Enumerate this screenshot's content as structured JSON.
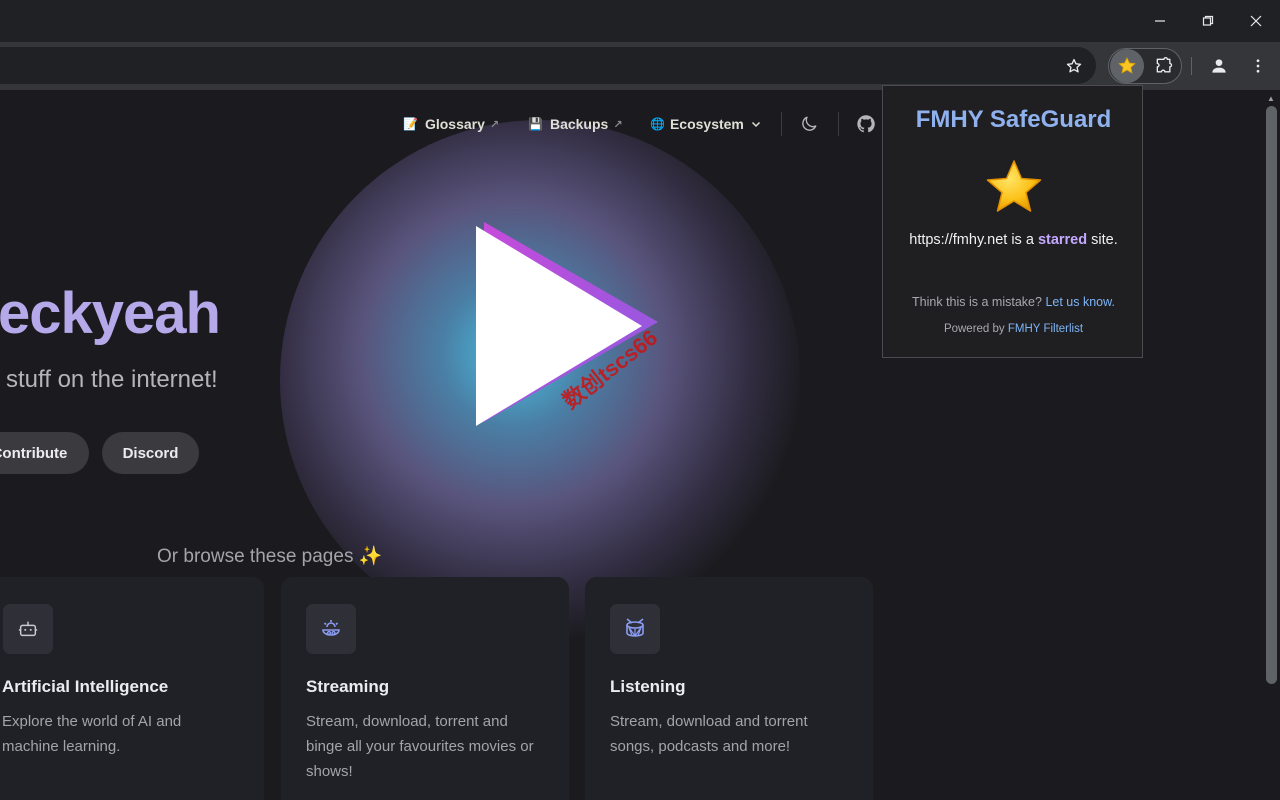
{
  "window": {
    "controls": [
      "minimize-icon",
      "restore-icon",
      "close-icon"
    ]
  },
  "toolbar": {
    "icons": [
      "bookmark-star-icon",
      "fmhy-safeguard-extension-icon",
      "extensions-puzzle-icon",
      "profile-icon",
      "menu-kebab-icon"
    ]
  },
  "site": {
    "nav": {
      "glossary": "Glossary",
      "glossary_emoji": "📝",
      "backups": "Backups",
      "backups_emoji": "💾",
      "ecosystem": "Ecosystem",
      "ecosystem_emoji": "🌐",
      "external_arrow": "↗"
    },
    "hero": {
      "name": "eckyeah",
      "tagline": "stuff on the internet!",
      "buttons": {
        "contribute": "Contribute",
        "discord": "Discord"
      }
    },
    "browse_heading": "Or browse these pages ✨",
    "cards": [
      {
        "title": "Artificial Intelligence",
        "desc": "Explore the world of AI and machine learning.",
        "icon": "robot-icon"
      },
      {
        "title": "Streaming",
        "desc": "Stream, download, torrent and binge all your favourites movies or shows!",
        "icon": "streaming-icon"
      },
      {
        "title": "Listening",
        "desc": "Stream, download and torrent songs, podcasts and more!",
        "icon": "drum-icon"
      }
    ],
    "watermark": "数创tscs66"
  },
  "popup": {
    "title": "FMHY SafeGuard",
    "status_prefix": "https://fmhy.net is a",
    "status_highlight": "starred",
    "status_suffix": "site.",
    "mistake_text": "Think this is a mistake?",
    "mistake_link": "Let us know",
    "mistake_period": ".",
    "powered_prefix": "Powered by",
    "powered_link": "FMHY Filterlist"
  },
  "colors": {
    "brand_purple": "#b5a9ea",
    "popup_title": "#8fb2ee",
    "link_blue": "#7eb4f5",
    "starred_purple": "#c4a8ff"
  }
}
